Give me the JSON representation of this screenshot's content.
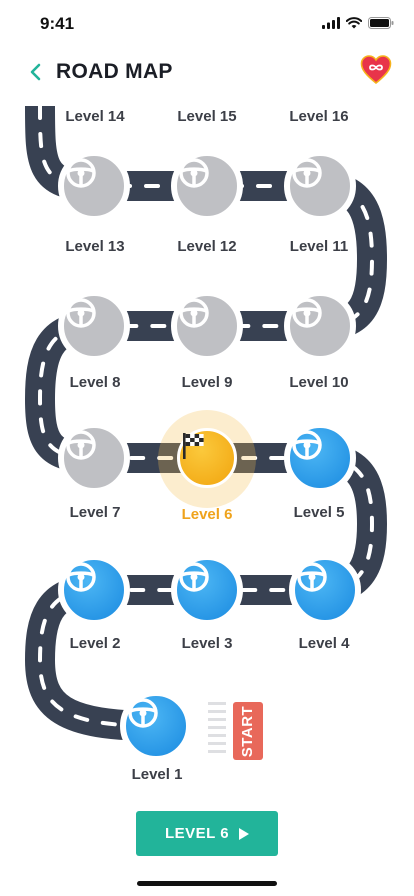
{
  "status": {
    "time": "9:41"
  },
  "header": {
    "title": "ROAD MAP"
  },
  "levels": [
    {
      "label": "Level 1",
      "state": "done"
    },
    {
      "label": "Level 2",
      "state": "done"
    },
    {
      "label": "Level 3",
      "state": "done"
    },
    {
      "label": "Level 4",
      "state": "done"
    },
    {
      "label": "Level 5",
      "state": "done"
    },
    {
      "label": "Level 6",
      "state": "current"
    },
    {
      "label": "Level 7",
      "state": "locked"
    },
    {
      "label": "Level 8",
      "state": "locked"
    },
    {
      "label": "Level 9",
      "state": "locked"
    },
    {
      "label": "Level 10",
      "state": "locked"
    },
    {
      "label": "Level 11",
      "state": "locked"
    },
    {
      "label": "Level 12",
      "state": "locked"
    },
    {
      "label": "Level 13",
      "state": "locked"
    },
    {
      "label": "Level 14",
      "state": "locked"
    },
    {
      "label": "Level 15",
      "state": "locked"
    },
    {
      "label": "Level 16",
      "state": "locked"
    }
  ],
  "start": {
    "label": "START"
  },
  "cta": {
    "label": "LEVEL 6"
  },
  "icons": {
    "back": "chevron-left-icon",
    "lives": "heart-infinity-icon",
    "done_level": "steering-wheel-icon",
    "locked_level": "steering-wheel-icon",
    "current_level": "checkered-flag-icon",
    "cta": "play-icon"
  },
  "colors": {
    "road": "#384152",
    "done": "#1e9ae8",
    "current": "#f6b21c",
    "locked": "#bfc0c4",
    "cta": "#22b49a",
    "start": "#e8685a",
    "accent_back": "#22b49a"
  }
}
